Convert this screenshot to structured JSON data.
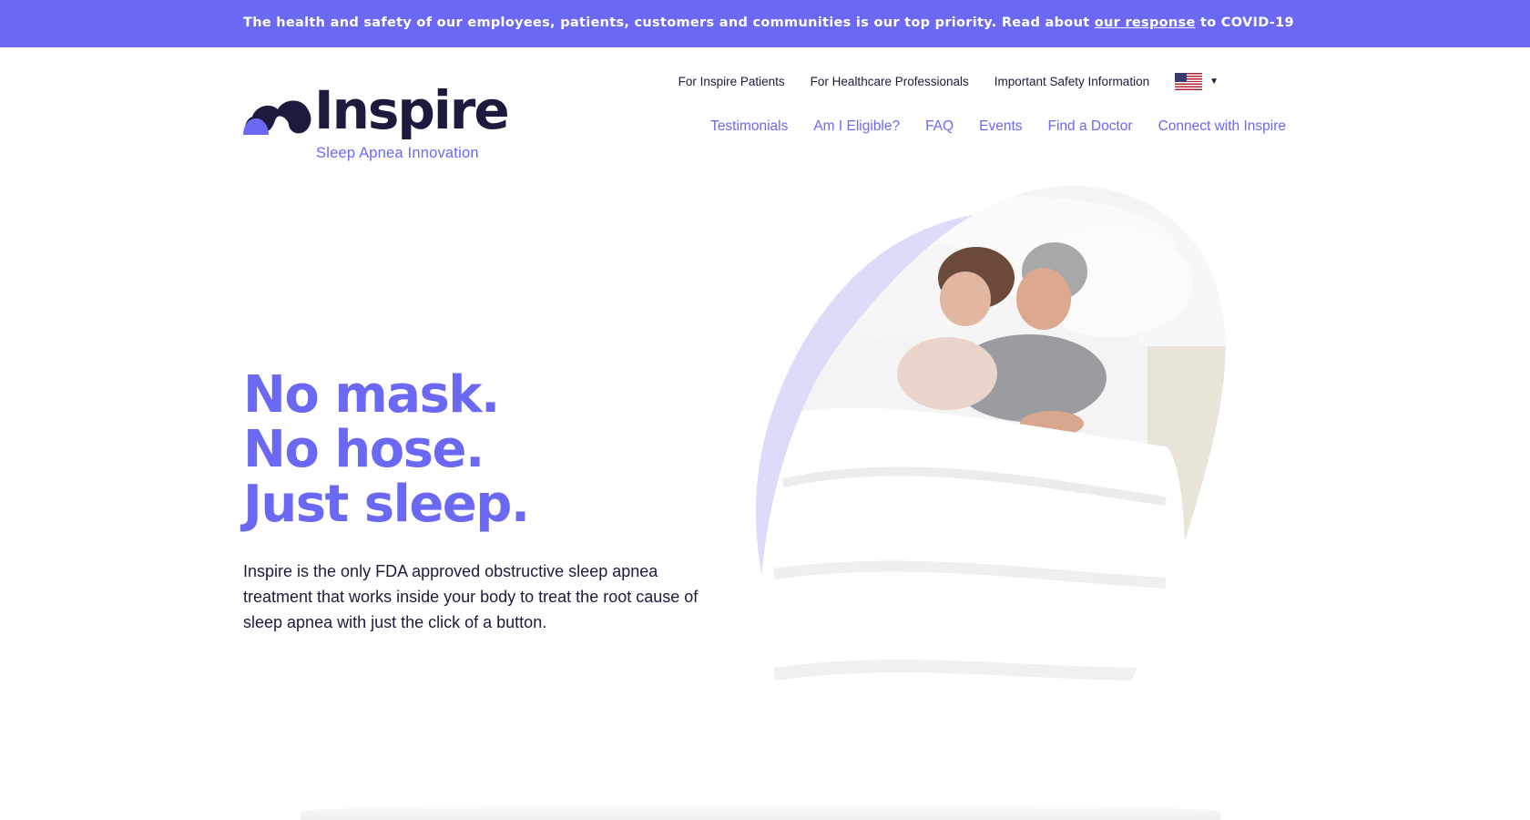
{
  "banner": {
    "text_before": "The health and safety of our employees, patients, customers and communities is our top priority. Read about ",
    "link": "our response",
    "text_after": " to COVID-19"
  },
  "logo": {
    "word": "Inspire",
    "tagline": "Sleep Apnea Innovation",
    "icon": "cloud-icon"
  },
  "utility_nav": [
    "For Inspire Patients",
    "For Healthcare Professionals",
    "Important Safety Information"
  ],
  "country_selector": {
    "icon": "us-flag-icon",
    "caret_icon": "caret-down-icon"
  },
  "main_nav": [
    "Testimonials",
    "Am I Eligible?",
    "FAQ",
    "Events",
    "Find a Doctor",
    "Connect with Inspire"
  ],
  "hero": {
    "lines": [
      "No mask.",
      "No hose.",
      "Just sleep."
    ],
    "description": "Inspire is the only FDA approved obstructive sleep apnea treatment that works inside your body to treat the root cause of sleep apnea with just the click of a button."
  },
  "colors": {
    "brand_purple": "#6b68f4",
    "navy": "#1c1a3d",
    "lavender": "#dcdbf9"
  }
}
